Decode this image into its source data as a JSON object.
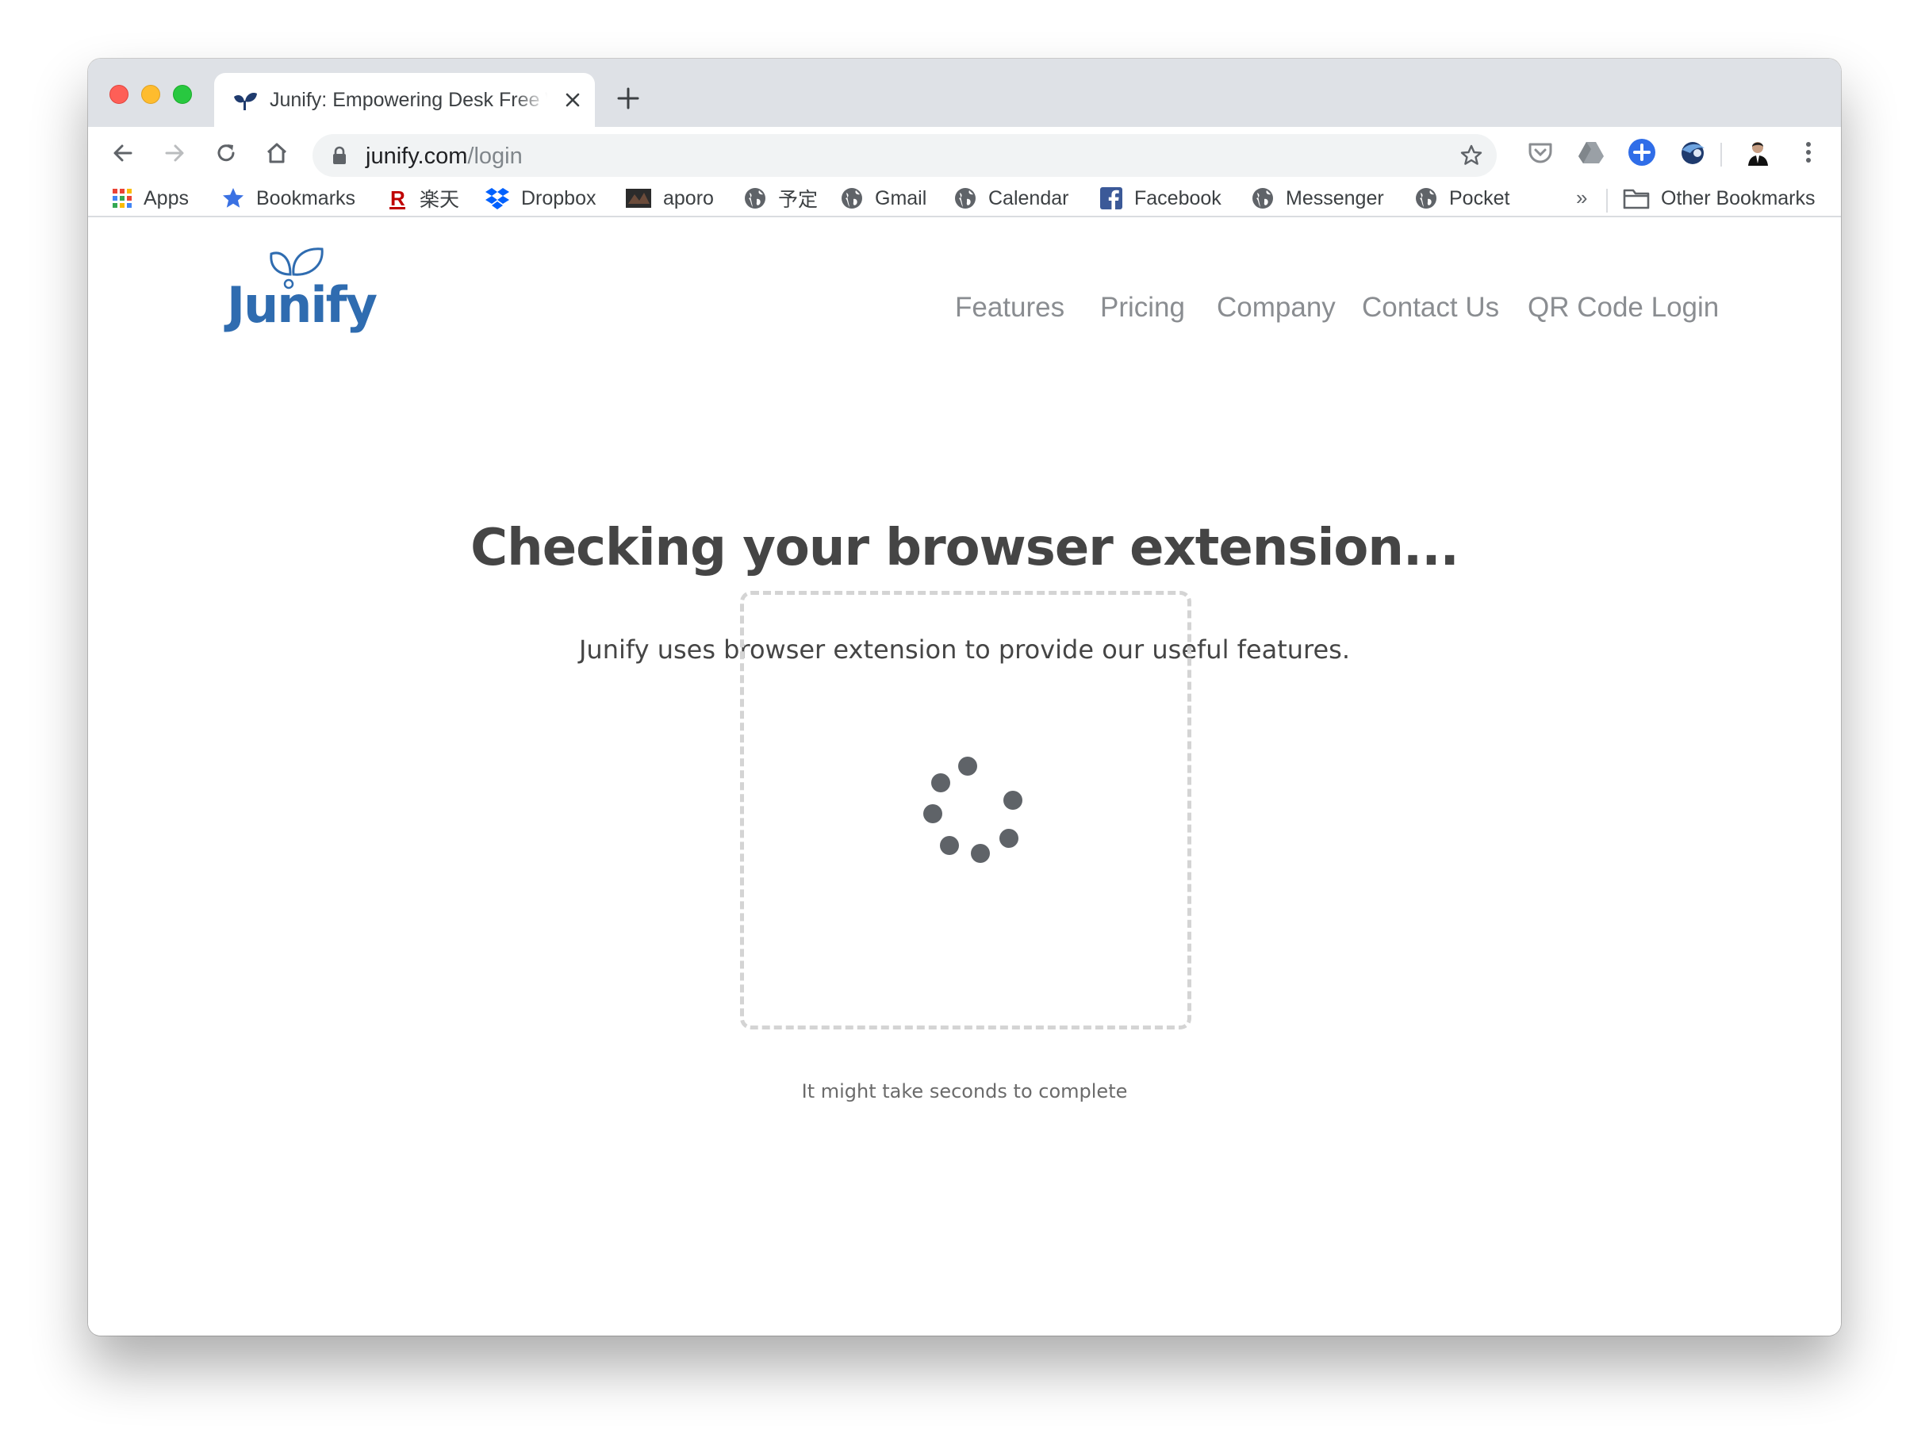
{
  "browser": {
    "tab": {
      "title": "Junify: Empowering Desk Free Workers"
    },
    "address_bar": {
      "domain": "junify.com",
      "path": "/login"
    },
    "bookmarks": [
      {
        "label": "Apps",
        "icon": "apps-grid-icon"
      },
      {
        "label": "Bookmarks",
        "icon": "star-icon"
      },
      {
        "label": "楽天",
        "icon": "rakuten-icon"
      },
      {
        "label": "Dropbox",
        "icon": "dropbox-icon"
      },
      {
        "label": "aporo",
        "icon": "aporo-icon"
      },
      {
        "label": "予定",
        "icon": "globe-icon"
      },
      {
        "label": "Gmail",
        "icon": "globe-icon"
      },
      {
        "label": "Calendar",
        "icon": "globe-icon"
      },
      {
        "label": "Facebook",
        "icon": "facebook-icon"
      },
      {
        "label": "Messenger",
        "icon": "globe-icon"
      },
      {
        "label": "Pocket",
        "icon": "globe-icon"
      }
    ],
    "overflow_label": "»",
    "other_bookmarks": "Other Bookmarks"
  },
  "site": {
    "logo_text": "Junify",
    "nav": [
      "Features",
      "Pricing",
      "Company",
      "Contact Us",
      "QR Code Login"
    ],
    "heading": "Checking your browser extension...",
    "subheading": "Junify uses browser extension to provide our useful features.",
    "footnote": "It might take seconds to complete"
  },
  "colors": {
    "brand": "#2f6cb0",
    "nav_text": "#8a8d91",
    "heading": "#454545",
    "spinner": "#5f6368"
  }
}
